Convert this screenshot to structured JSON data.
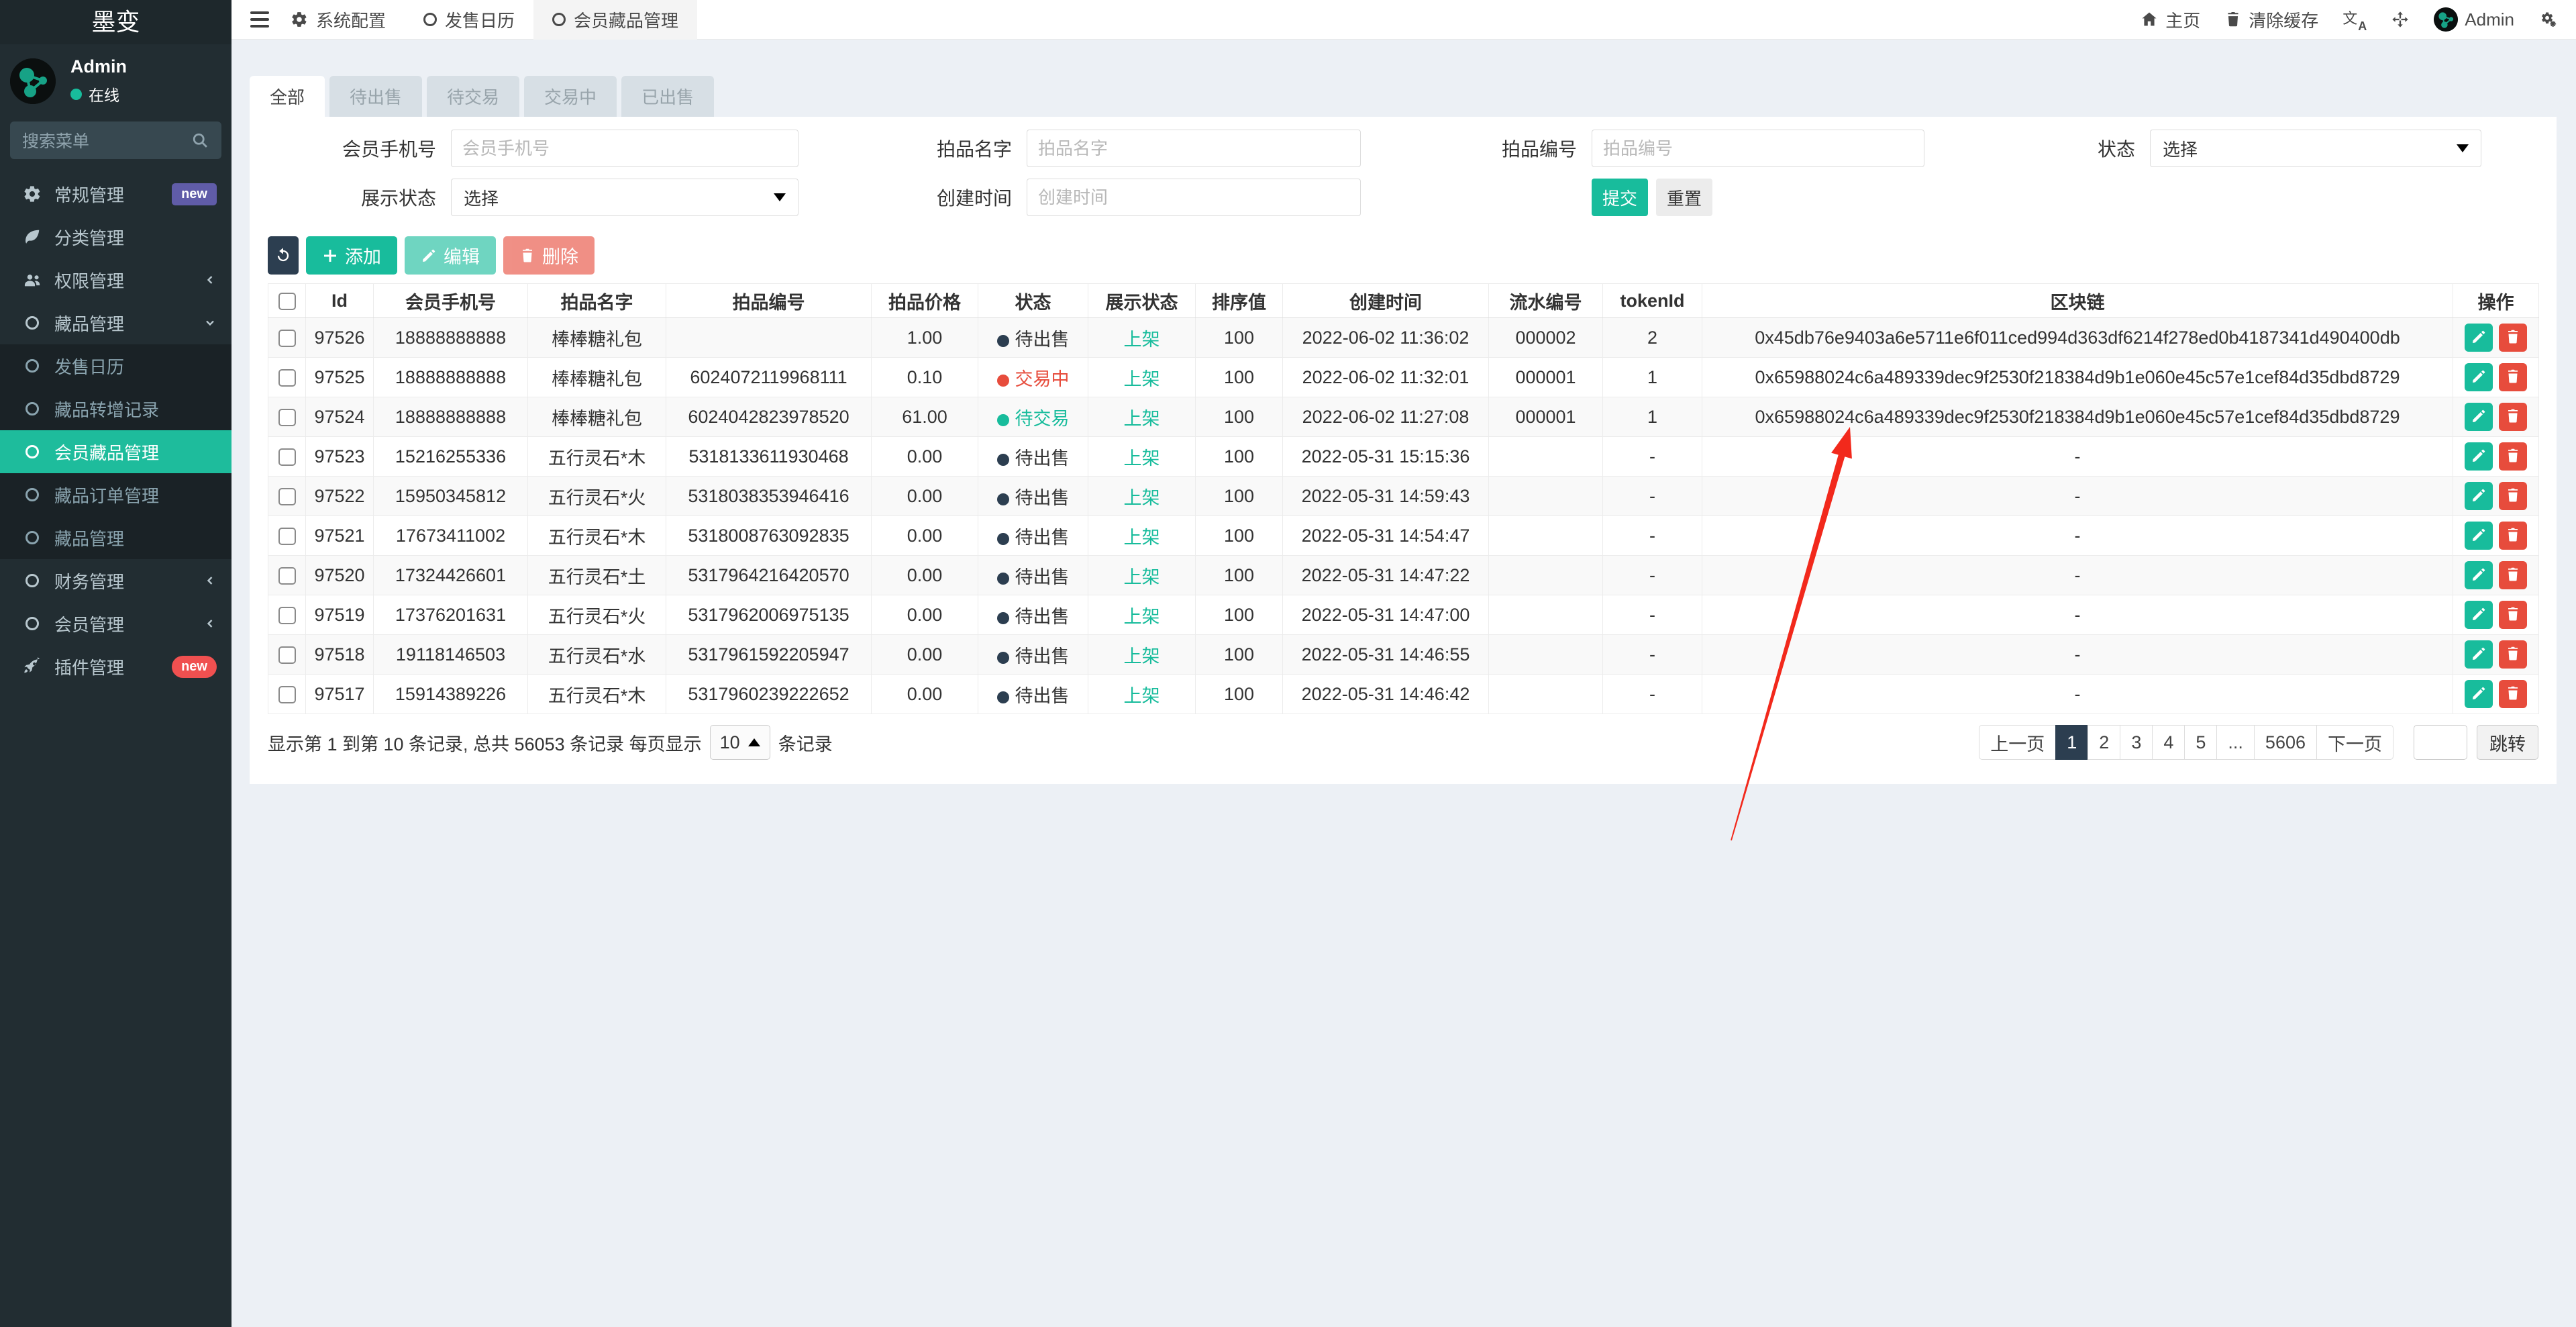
{
  "brand": "墨变",
  "colors": {
    "accent_teal": "#18bc9c",
    "navy": "#2c3e50",
    "danger_red": "#e74c3c",
    "badge_purple": "#605ca8",
    "badge_red": "#f05050",
    "active_menu": "#1ebc9c",
    "annotation_arrow": "#f2291c"
  },
  "sidebar": {
    "user": {
      "name": "Admin",
      "status": "在线"
    },
    "search_placeholder": "搜索菜单",
    "menu": [
      {
        "label": "常规管理",
        "badge": "new"
      },
      {
        "label": "分类管理"
      },
      {
        "label": "权限管理"
      },
      {
        "label": "藏品管理"
      },
      {
        "label": "发售日历"
      },
      {
        "label": "藏品转增记录"
      },
      {
        "label": "会员藏品管理"
      },
      {
        "label": "藏品订单管理"
      },
      {
        "label": "藏品管理"
      },
      {
        "label": "财务管理"
      },
      {
        "label": "会员管理"
      },
      {
        "label": "插件管理",
        "badge": "new"
      }
    ]
  },
  "navbar": {
    "tabs": [
      {
        "label": "系统配置"
      },
      {
        "label": "发售日历"
      },
      {
        "label": "会员藏品管理"
      }
    ],
    "home": "主页",
    "clear_cache": "清除缓存",
    "user": "Admin"
  },
  "tabs": [
    "全部",
    "待出售",
    "待交易",
    "交易中",
    "已出售"
  ],
  "filters": {
    "member_phone": {
      "label": "会员手机号",
      "placeholder": "会员手机号"
    },
    "item_name": {
      "label": "拍品名字",
      "placeholder": "拍品名字"
    },
    "item_sn": {
      "label": "拍品编号",
      "placeholder": "拍品编号"
    },
    "status": {
      "label": "状态",
      "value": "选择"
    },
    "display_status": {
      "label": "展示状态",
      "value": "选择"
    },
    "created": {
      "label": "创建时间",
      "placeholder": "创建时间"
    },
    "submit": "提交",
    "reset": "重置"
  },
  "toolbar": {
    "add": "添加",
    "edit": "编辑",
    "delete": "删除"
  },
  "table": {
    "headers": [
      "Id",
      "会员手机号",
      "拍品名字",
      "拍品编号",
      "拍品价格",
      "状态",
      "展示状态",
      "排序值",
      "创建时间",
      "流水编号",
      "tokenId",
      "区块链",
      "操作"
    ],
    "rows": [
      {
        "id": "97526",
        "phone": "18888888888",
        "name": "棒棒糖礼包",
        "sn": "",
        "price": "1.00",
        "status": {
          "text": "待出售",
          "dot": "#2c3e50",
          "color": "#333333"
        },
        "display_status": "上架",
        "sort": "100",
        "created": "2022-06-02 11:36:02",
        "flow_no": "000002",
        "token_id": "2",
        "chain": "0x45db76e9403a6e5711e6f011ced994d363df6214f278ed0b4187341d490400db"
      },
      {
        "id": "97525",
        "phone": "18888888888",
        "name": "棒棒糖礼包",
        "sn": "6024072119968111",
        "price": "0.10",
        "status": {
          "text": "交易中",
          "dot": "#e74c3c",
          "color": "#e74c3c"
        },
        "display_status": "上架",
        "sort": "100",
        "created": "2022-06-02 11:32:01",
        "flow_no": "000001",
        "token_id": "1",
        "chain": "0x65988024c6a489339dec9f2530f218384d9b1e060e45c57e1cef84d35dbd8729"
      },
      {
        "id": "97524",
        "phone": "18888888888",
        "name": "棒棒糖礼包",
        "sn": "6024042823978520",
        "price": "61.00",
        "status": {
          "text": "待交易",
          "dot": "#18bc9c",
          "color": "#18bc9c"
        },
        "display_status": "上架",
        "sort": "100",
        "created": "2022-06-02 11:27:08",
        "flow_no": "000001",
        "token_id": "1",
        "chain": "0x65988024c6a489339dec9f2530f218384d9b1e060e45c57e1cef84d35dbd8729"
      },
      {
        "id": "97523",
        "phone": "15216255336",
        "name": "五行灵石*木",
        "sn": "5318133611930468",
        "price": "0.00",
        "status": {
          "text": "待出售",
          "dot": "#2c3e50",
          "color": "#333333"
        },
        "display_status": "上架",
        "sort": "100",
        "created": "2022-05-31 15:15:36",
        "flow_no": "",
        "token_id": "-",
        "chain": "-"
      },
      {
        "id": "97522",
        "phone": "15950345812",
        "name": "五行灵石*火",
        "sn": "5318038353946416",
        "price": "0.00",
        "status": {
          "text": "待出售",
          "dot": "#2c3e50",
          "color": "#333333"
        },
        "display_status": "上架",
        "sort": "100",
        "created": "2022-05-31 14:59:43",
        "flow_no": "",
        "token_id": "-",
        "chain": "-"
      },
      {
        "id": "97521",
        "phone": "17673411002",
        "name": "五行灵石*木",
        "sn": "5318008763092835",
        "price": "0.00",
        "status": {
          "text": "待出售",
          "dot": "#2c3e50",
          "color": "#333333"
        },
        "display_status": "上架",
        "sort": "100",
        "created": "2022-05-31 14:54:47",
        "flow_no": "",
        "token_id": "-",
        "chain": "-"
      },
      {
        "id": "97520",
        "phone": "17324426601",
        "name": "五行灵石*土",
        "sn": "5317964216420570",
        "price": "0.00",
        "status": {
          "text": "待出售",
          "dot": "#2c3e50",
          "color": "#333333"
        },
        "display_status": "上架",
        "sort": "100",
        "created": "2022-05-31 14:47:22",
        "flow_no": "",
        "token_id": "-",
        "chain": "-"
      },
      {
        "id": "97519",
        "phone": "17376201631",
        "name": "五行灵石*火",
        "sn": "5317962006975135",
        "price": "0.00",
        "status": {
          "text": "待出售",
          "dot": "#2c3e50",
          "color": "#333333"
        },
        "display_status": "上架",
        "sort": "100",
        "created": "2022-05-31 14:47:00",
        "flow_no": "",
        "token_id": "-",
        "chain": "-"
      },
      {
        "id": "97518",
        "phone": "19118146503",
        "name": "五行灵石*水",
        "sn": "5317961592205947",
        "price": "0.00",
        "status": {
          "text": "待出售",
          "dot": "#2c3e50",
          "color": "#333333"
        },
        "display_status": "上架",
        "sort": "100",
        "created": "2022-05-31 14:46:55",
        "flow_no": "",
        "token_id": "-",
        "chain": "-"
      },
      {
        "id": "97517",
        "phone": "15914389226",
        "name": "五行灵石*木",
        "sn": "5317960239222652",
        "price": "0.00",
        "status": {
          "text": "待出售",
          "dot": "#2c3e50",
          "color": "#333333"
        },
        "display_status": "上架",
        "sort": "100",
        "created": "2022-05-31 14:46:42",
        "flow_no": "",
        "token_id": "-",
        "chain": "-"
      }
    ]
  },
  "footer": {
    "summary_prefix": "显示第 1 到第 10 条记录, 总共 56053 条记录 每页显示",
    "summary_suffix": "条记录",
    "page_size": "10",
    "pagination": [
      "上一页",
      "1",
      "2",
      "3",
      "4",
      "5",
      "...",
      "5606",
      "下一页"
    ],
    "active_page": "1",
    "jump": "跳转"
  }
}
